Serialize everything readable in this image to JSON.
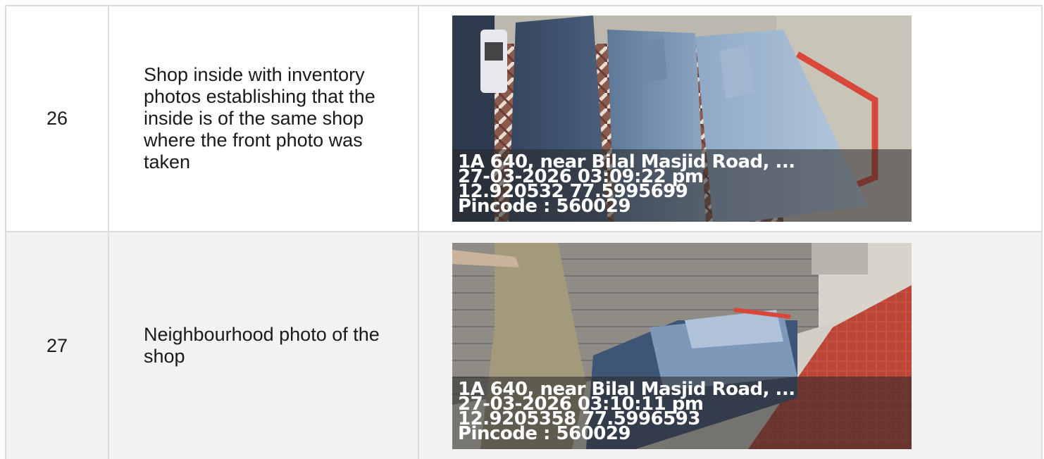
{
  "rows": [
    {
      "number": "26",
      "description": "Shop inside with inventory photos establishing that the inside is of the same shop where the front photo was taken",
      "stamp": {
        "address": "1A 640, near Bilal Masjid Road, ...",
        "datetime": "27-03-2026 03:09:22 pm",
        "coordinates": "12.920532 77.5995699",
        "pincode": "Pincode : 560029"
      }
    },
    {
      "number": "27",
      "description": "Neighbourhood photo of the shop",
      "stamp": {
        "address": "1A 640, near Bilal Masjid Road, ...",
        "datetime": "27-03-2026 03:10:11 pm",
        "coordinates": "12.9205358 77.5996593",
        "pincode": "Pincode : 560029"
      }
    }
  ]
}
